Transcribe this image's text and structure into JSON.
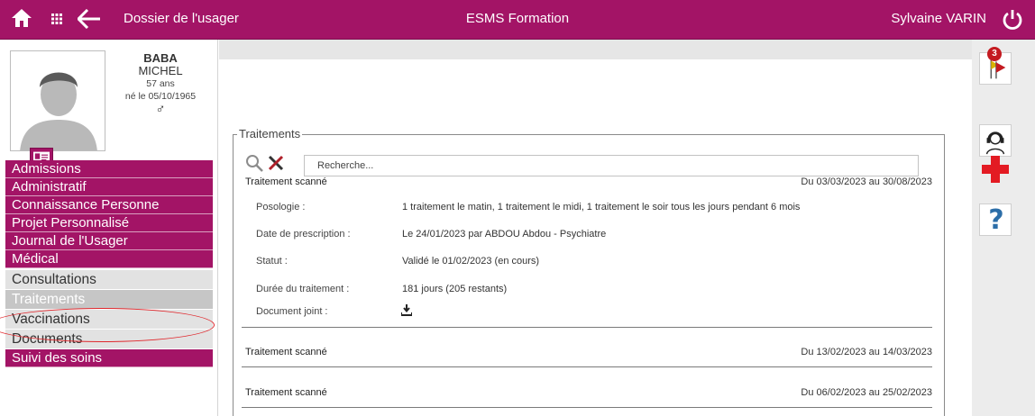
{
  "topbar": {
    "breadcrumb": "Dossier de l'usager",
    "app_title": "ESMS Formation",
    "user_name": "Sylvaine VARIN"
  },
  "patient": {
    "last_name": "BABA",
    "first_name": "MICHEL",
    "age": "57 ans",
    "birth": "né le 05/10/1965",
    "sex_symbol": "♂"
  },
  "menu": {
    "items": [
      {
        "label": "Admissions"
      },
      {
        "label": "Administratif"
      },
      {
        "label": "Connaissance Personne"
      },
      {
        "label": "Projet Personnalisé"
      },
      {
        "label": "Journal de l'Usager"
      },
      {
        "label": "Médical"
      },
      {
        "label": "Consultations"
      },
      {
        "label": "Traitements"
      },
      {
        "label": "Vaccinations"
      },
      {
        "label": "Documents"
      },
      {
        "label": "Suivi des soins"
      }
    ]
  },
  "section": {
    "legend": "Traitements",
    "search_placeholder": "Recherche..."
  },
  "treatments": [
    {
      "title": "Traitement scanné",
      "period": "Du 03/03/2023 au 30/08/2023",
      "details": [
        {
          "label": "Posologie :",
          "value": "1 traitement le matin, 1 traitement le midi, 1 traitement le soir tous les jours pendant 6 mois"
        },
        {
          "label": "Date de prescription :",
          "value": "Le 24/01/2023 par ABDOU Abdou - Psychiatre"
        },
        {
          "label": "Statut :",
          "value": "Validé le 01/02/2023 (en cours)"
        },
        {
          "label": "Durée du traitement :",
          "value": "181 jours (205 restants)"
        },
        {
          "label": "Document joint :",
          "value": ""
        }
      ]
    },
    {
      "title": "Traitement scanné",
      "period": "Du 13/02/2023 au 14/03/2023"
    },
    {
      "title": "Traitement scanné",
      "period": "Du 06/02/2023 au 25/02/2023"
    }
  ],
  "right_panel": {
    "alert_badge": "3",
    "help_label": "?"
  },
  "colors": {
    "brand": "#a31466",
    "menu_sub": "#e2e2e2",
    "highlight_oval": "#e0262b"
  },
  "icons": {
    "home": "home-icon",
    "apps": "grid-icon",
    "back": "arrow-left-icon",
    "power": "power-icon",
    "search": "magnifier-icon",
    "clear": "x-icon",
    "download": "download-icon",
    "alerts": "flag-alert-icon",
    "support": "headset-icon",
    "medical": "red-cross-icon",
    "help": "question-icon"
  }
}
